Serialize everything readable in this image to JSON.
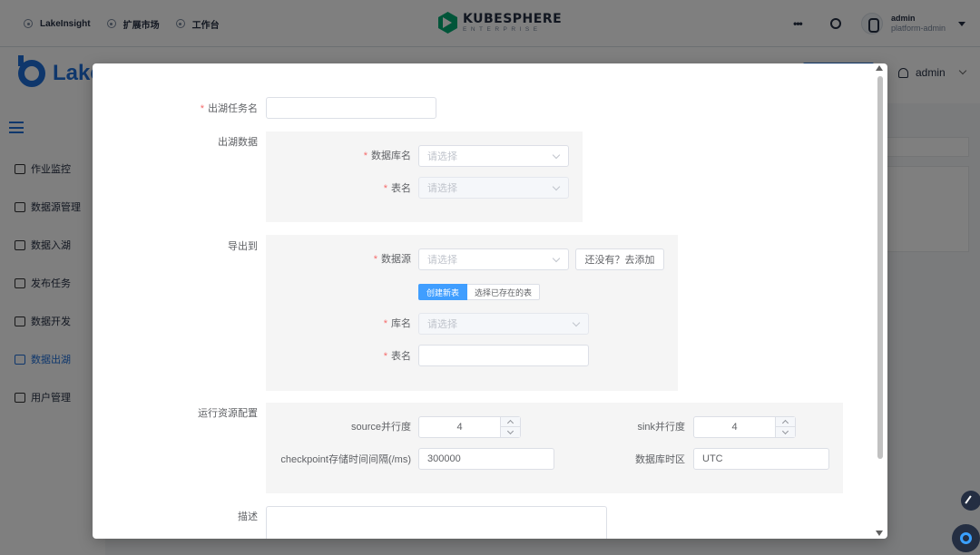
{
  "platform": {
    "nav": [
      {
        "label": "LakeInsight"
      },
      {
        "label": "扩展市场"
      },
      {
        "label": "工作台"
      }
    ],
    "brand": {
      "title": "KUBESPHERE",
      "subtitle": "ENTERPRISE"
    },
    "user": {
      "name": "admin",
      "role": "platform-admin"
    }
  },
  "app": {
    "logo_text": "Lake",
    "user": "admin",
    "sidebar": [
      {
        "label": "作业监控"
      },
      {
        "label": "数据源管理"
      },
      {
        "label": "数据入湖"
      },
      {
        "label": "发布任务"
      },
      {
        "label": "数据开发"
      },
      {
        "label": "数据出湖",
        "active": true
      },
      {
        "label": "用户管理"
      }
    ]
  },
  "form": {
    "task_name": {
      "label": "出湖任务名",
      "value": ""
    },
    "source_section": {
      "label": "出湖数据",
      "database": {
        "label": "数据库名",
        "placeholder": "请选择"
      },
      "table": {
        "label": "表名",
        "placeholder": "请选择"
      }
    },
    "export_section": {
      "label": "导出到",
      "datasource": {
        "label": "数据源",
        "placeholder": "请选择"
      },
      "add_link": "还没有？去添加",
      "mode_tabs": [
        {
          "label": "创建新表",
          "active": true
        },
        {
          "label": "选择已存在的表",
          "active": false
        }
      ],
      "database": {
        "label": "库名",
        "placeholder": "请选择"
      },
      "table": {
        "label": "表名",
        "value": ""
      }
    },
    "resource_section": {
      "label": "运行资源配置",
      "source_parallelism": {
        "label": "source并行度",
        "value": "4"
      },
      "sink_parallelism": {
        "label": "sink并行度",
        "value": "4"
      },
      "checkpoint_interval": {
        "label": "checkpoint存储时间间隔(/ms)",
        "value": "300000"
      },
      "db_timezone": {
        "label": "数据库时区",
        "value": "UTC"
      }
    },
    "description": {
      "label": "描述",
      "value": ""
    }
  },
  "colors": {
    "primary": "#409eff",
    "required": "#f56c6c",
    "brand_green": "#00aa72",
    "app_blue": "#1e6fd9"
  }
}
